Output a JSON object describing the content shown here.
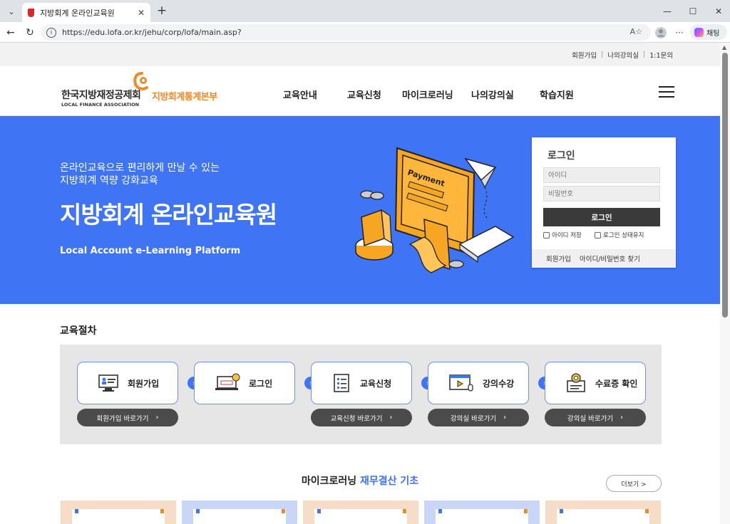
{
  "browser": {
    "tab_title": "지방회계 온라인교육원",
    "url": "https://edu.lofa.or.kr/jehu/corp/lofa/main.asp?",
    "copilot_label": "채팅"
  },
  "utility": {
    "items": [
      "회원가입",
      "나의강의실",
      "1:1문의"
    ]
  },
  "header": {
    "logo_kr": "한국지방재정공제회",
    "logo_en": "LOCAL FINANCE ASSOCIATION",
    "logo_sub": "지방회계통계본부",
    "nav": [
      "교육안내",
      "교육신청",
      "마이크로러닝",
      "나의강의실",
      "학습지원"
    ]
  },
  "hero": {
    "sub_line1": "온라인교육으로 편리하게 만날 수 있는",
    "sub_line2": "지방회계 역량 강화교육",
    "title": "지방회계 온라인교육원",
    "tagline": "Local Account e-Learning Platform",
    "illustration_text": "Payment"
  },
  "login": {
    "title": "로그인",
    "id_placeholder": "아이디",
    "pw_placeholder": "비밀번호",
    "button": "로그인",
    "save_id": "아이디 저장",
    "keep_login": "로그인 상태유지",
    "join": "회원가입",
    "find": "아이디/비밀번호 찾기"
  },
  "procedure": {
    "title": "교육절차",
    "steps": [
      "회원가입",
      "로그인",
      "교육신청",
      "강의수강",
      "수료증 확인"
    ],
    "buttons": [
      "회원가입 바로가기",
      "교육신청 바로가기",
      "강의실 바로가기",
      "강의실 바로가기"
    ]
  },
  "micro": {
    "title_plain": "마이크로러닝",
    "title_accent": "재무결산 기초",
    "more": "더보기 >"
  },
  "colors": {
    "brand_blue": "#3f74f5",
    "brand_orange": "#f08a24",
    "dark_button": "#3a3a3a"
  }
}
